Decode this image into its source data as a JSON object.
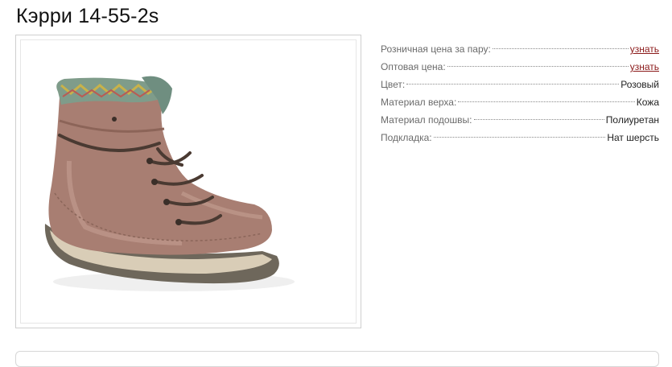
{
  "product": {
    "title": "Кэрри 14-55-2s"
  },
  "specs": [
    {
      "label": "Розничная цена за пару:",
      "value": "узнать",
      "is_link": true
    },
    {
      "label": "Оптовая цена:",
      "value": "узнать",
      "is_link": true
    },
    {
      "label": "Цвет:",
      "value": "Розовый",
      "is_link": false
    },
    {
      "label": "Материал верха:",
      "value": "Кожа",
      "is_link": false
    },
    {
      "label": "Материал подошвы:",
      "value": "Полиуретан",
      "is_link": false
    },
    {
      "label": "Подкладка:",
      "value": "Нат шерсть",
      "is_link": false
    }
  ],
  "colors": {
    "link": "#8b1a1a",
    "label": "#6b6b6b",
    "boot_leather": "#a87e72",
    "sole": "#6e675b"
  },
  "image": {
    "subject": "boot-photo"
  }
}
